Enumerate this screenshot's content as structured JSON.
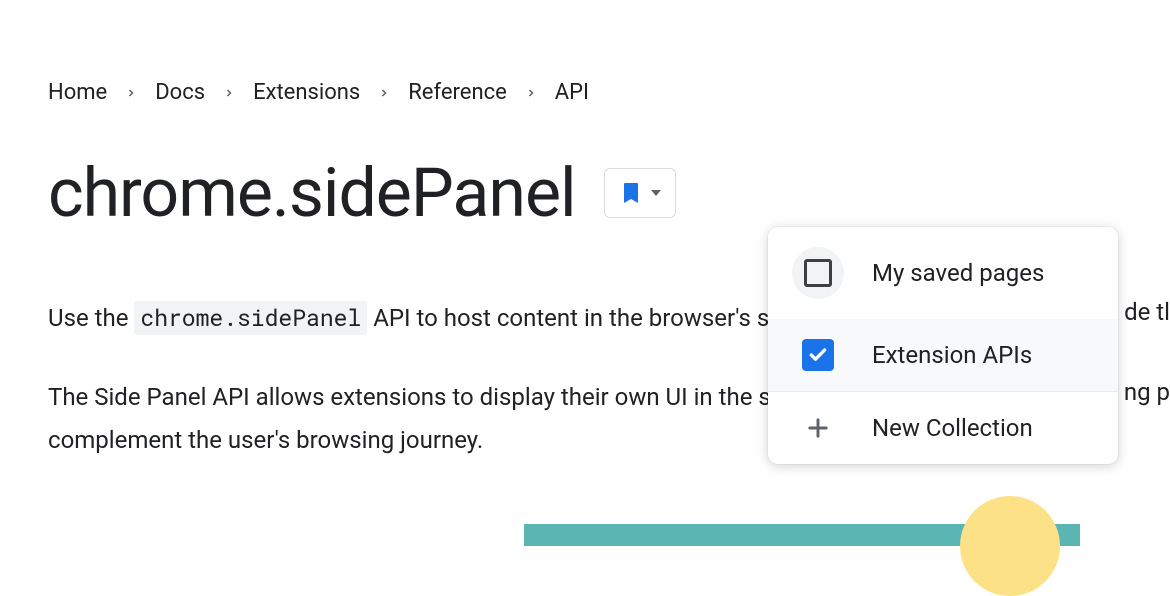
{
  "breadcrumb": {
    "items": [
      "Home",
      "Docs",
      "Extensions",
      "Reference",
      "API"
    ]
  },
  "page": {
    "title": "chrome.sidePanel"
  },
  "body": {
    "para1_prefix": "Use the ",
    "para1_code": "chrome.sidePanel",
    "para1_suffix": " API to host content in the browser's side panel alongside th",
    "para2": "The Side Panel API allows extensions to display their own UI in the side panel, enabling p",
    "para2_line2": "complement the user's browsing journey."
  },
  "dropdown": {
    "item1_label": "My saved pages",
    "item2_label": "Extension APIs",
    "item3_label": "New Collection"
  },
  "fragments": {
    "right1": "de tl",
    "right2": "ng p"
  }
}
